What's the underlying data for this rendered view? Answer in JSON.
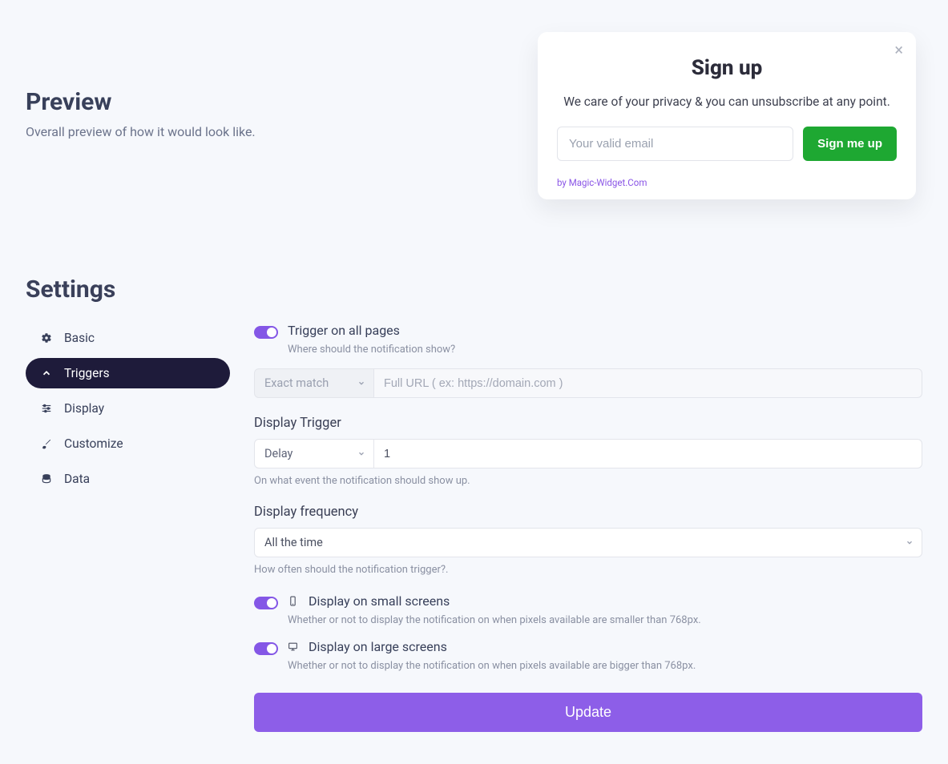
{
  "preview": {
    "title": "Preview",
    "subtitle": "Overall preview of how it would look like."
  },
  "signup": {
    "title": "Sign up",
    "description": "We care of your privacy & you can unsubscribe at any point.",
    "email_placeholder": "Your valid email",
    "button_label": "Sign me up",
    "footer": "by Magic-Widget.Com"
  },
  "settings": {
    "title": "Settings",
    "nav": {
      "basic": "Basic",
      "triggers": "Triggers",
      "display": "Display",
      "customize": "Customize",
      "data": "Data"
    },
    "triggers": {
      "trigger_all_pages": {
        "label": "Trigger on all pages",
        "help": "Where should the notification show?"
      },
      "url_rule": {
        "match_type": "Exact match",
        "url_placeholder": "Full URL ( ex: https://domain.com )"
      },
      "display_trigger": {
        "label": "Display Trigger",
        "type": "Delay",
        "value": "1",
        "help": "On what event the notification should show up."
      },
      "display_frequency": {
        "label": "Display frequency",
        "value": "All the time",
        "help": "How often should the notification trigger?."
      },
      "small_screens": {
        "label": "Display on small screens",
        "help": "Whether or not to display the notification on when pixels available are smaller than 768px."
      },
      "large_screens": {
        "label": "Display on large screens",
        "help": "Whether or not to display the notification on when pixels available are bigger than 768px."
      },
      "update_button": "Update"
    }
  }
}
